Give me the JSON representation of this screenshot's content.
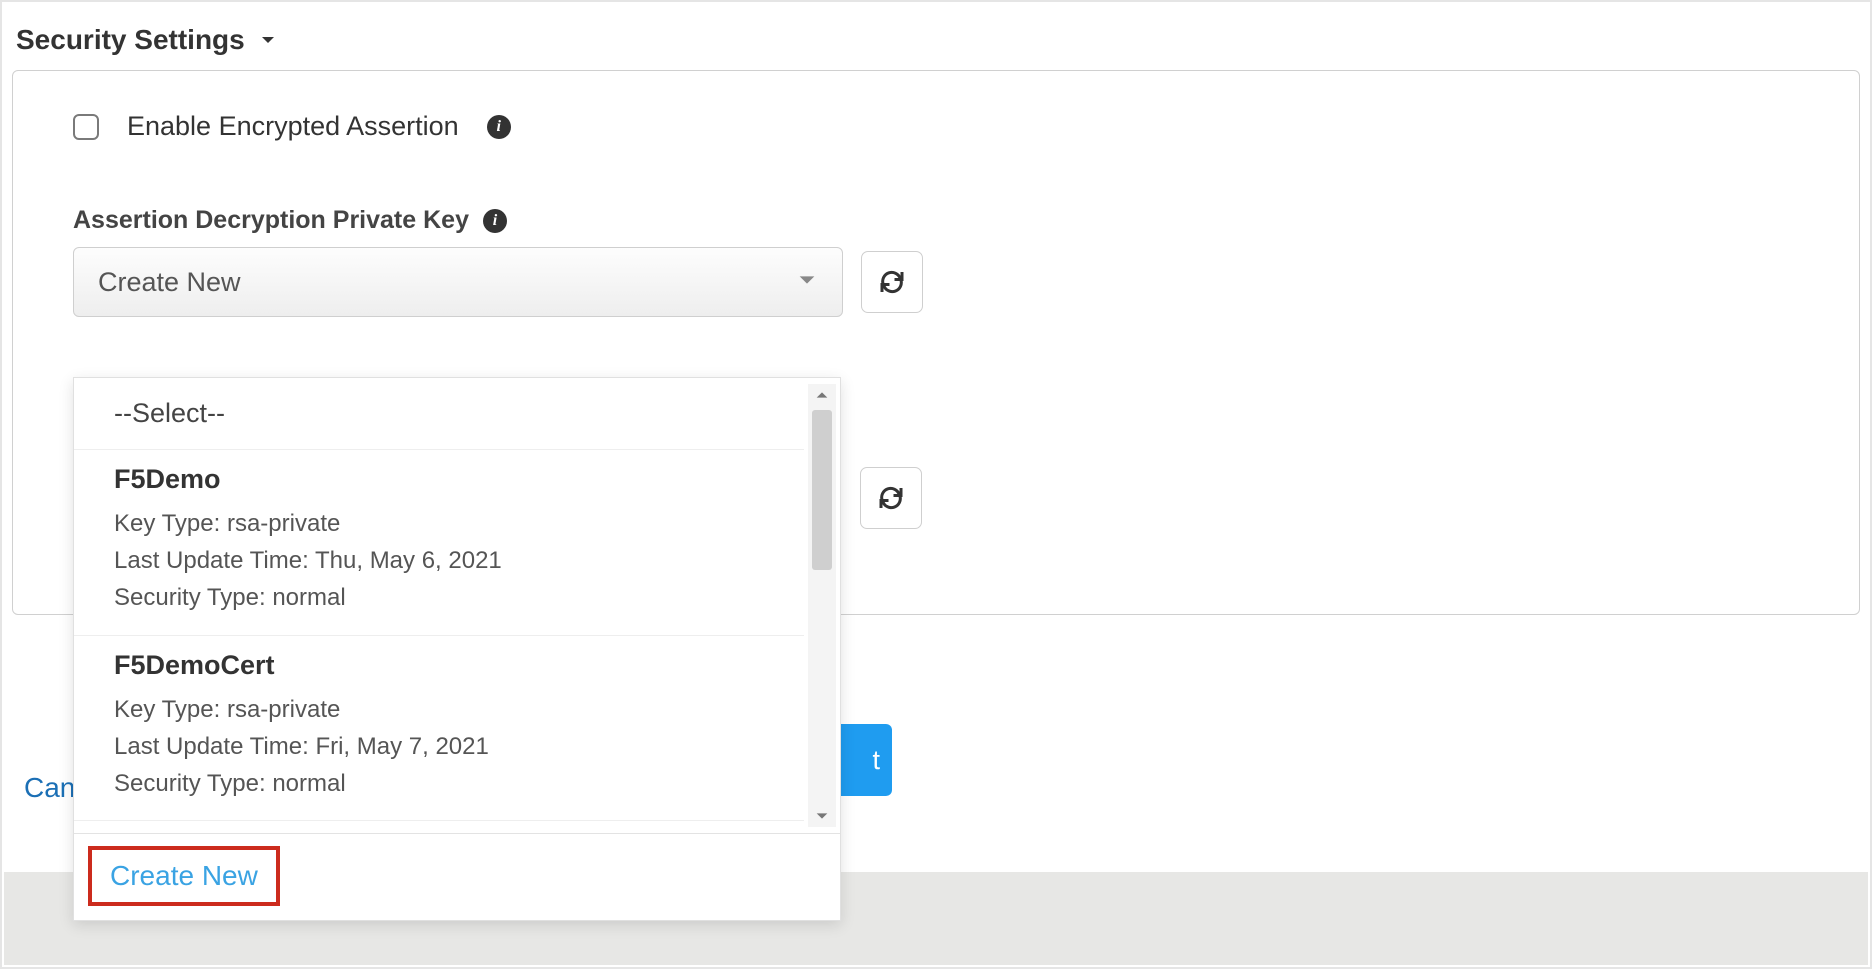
{
  "section": {
    "title": "Security Settings"
  },
  "checkbox": {
    "label": "Enable Encrypted Assertion"
  },
  "field": {
    "label": "Assertion Decryption Private Key",
    "selected": "Create New"
  },
  "dropdown": {
    "placeholder": "--Select--",
    "items": [
      {
        "name": "F5Demo",
        "key_type_label": "Key Type:",
        "key_type": "rsa-private",
        "last_update_label": "Last Update Time:",
        "last_update": "Thu, May 6, 2021",
        "security_type_label": "Security Type:",
        "security_type": "normal"
      },
      {
        "name": "F5DemoCert",
        "key_type_label": "Key Type:",
        "key_type": "rsa-private",
        "last_update_label": "Last Update Time:",
        "last_update": "Fri, May 7, 2021",
        "security_type_label": "Security Type:",
        "security_type": "normal"
      }
    ],
    "create_new": "Create New"
  },
  "footer": {
    "cancel": "Can",
    "next_fragment": "t"
  },
  "icons": {
    "info": "i"
  }
}
